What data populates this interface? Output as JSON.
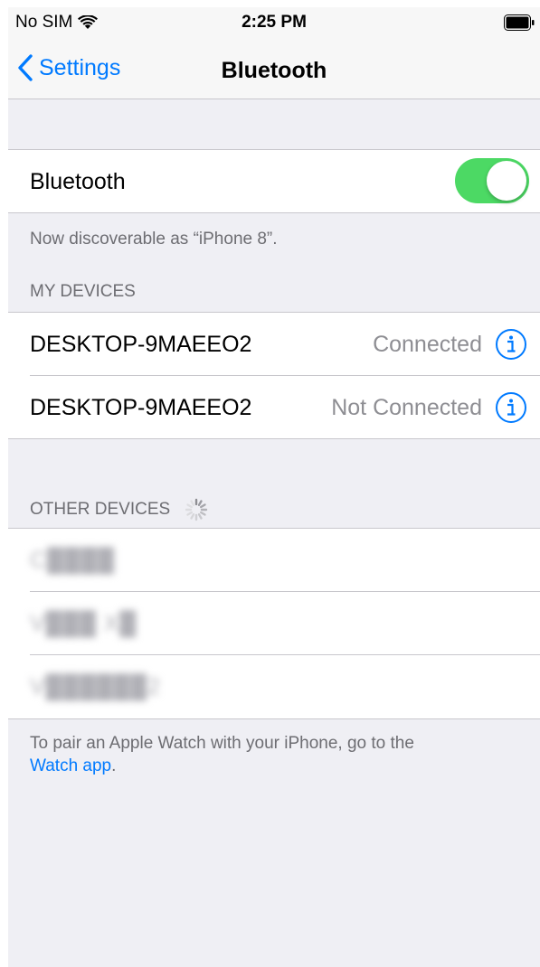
{
  "status_bar": {
    "carrier": "No SIM",
    "time": "2:25 PM",
    "icons": [
      "wifi-icon",
      "battery-icon"
    ]
  },
  "nav": {
    "back_label": "Settings",
    "title": "Bluetooth"
  },
  "bluetooth": {
    "label": "Bluetooth",
    "enabled": true,
    "discoverable_text": "Now discoverable as “iPhone 8”."
  },
  "my_devices": {
    "header": "MY DEVICES",
    "items": [
      {
        "name": "DESKTOP-9MAEEO2",
        "status": "Connected"
      },
      {
        "name": "DESKTOP-9MAEEO2",
        "status": "Not Connected"
      }
    ]
  },
  "other_devices": {
    "header": "OTHER DEVICES",
    "items": [
      {
        "name": "C████",
        "blurred": true
      },
      {
        "name": "V███ X█",
        "blurred": true
      },
      {
        "name": "V██████2",
        "blurred": true
      }
    ]
  },
  "footer": {
    "pair_text": "To pair an Apple Watch with your iPhone, go to the",
    "watch_link": "Watch app",
    "end_punct": "."
  },
  "colors": {
    "accent": "#007aff",
    "toggle_on": "#4cd964",
    "background": "#efeff4",
    "secondary_text": "#6d6d72",
    "status_text": "#8e8e93"
  }
}
